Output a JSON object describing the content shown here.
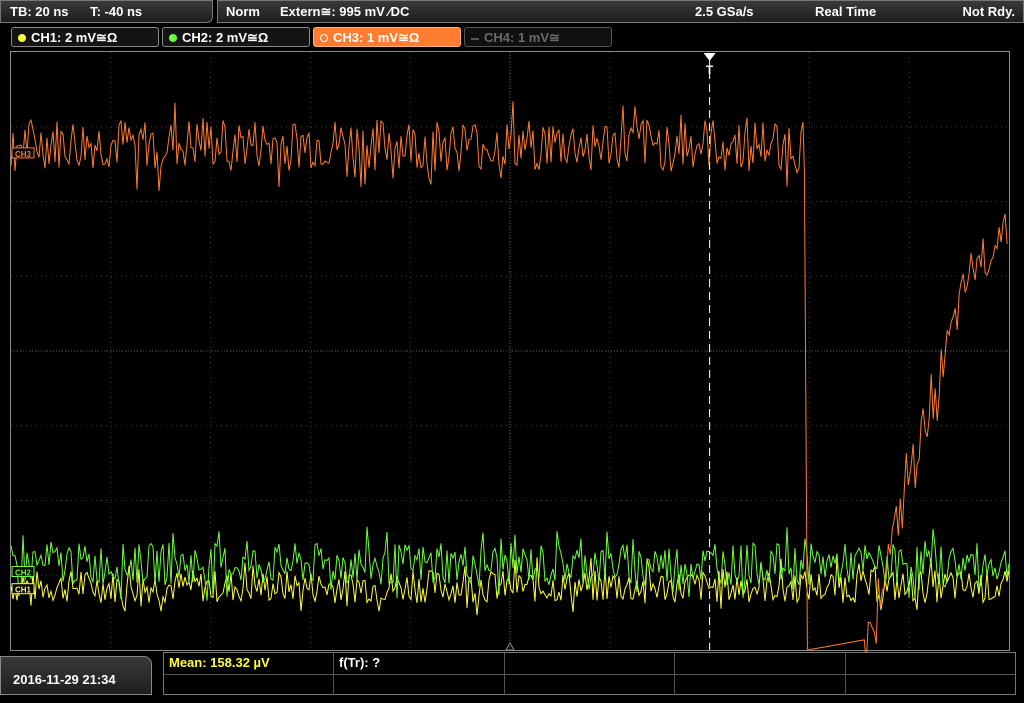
{
  "timebase": {
    "tb": "TB: 20 ns",
    "t": "T: -40 ns"
  },
  "status_bar": {
    "mode": "Norm",
    "trigger": "Extern≅: 995 mV ⁄DC",
    "sample_rate": "2.5 GSa/s",
    "acquisition": "Real Time",
    "ready_state": "Not Rdy."
  },
  "channels": [
    {
      "label": "CH1: 2 mV≅Ω",
      "color": "#ffff3a",
      "state": "on"
    },
    {
      "label": "CH2: 2 mV≅Ω",
      "color": "#6cff3a",
      "state": "on"
    },
    {
      "label": "CH3: 1 mV≅Ω",
      "color": "#ff7c30",
      "state": "selected"
    },
    {
      "label": "CH4: 1 mV≅",
      "color": "#666666",
      "state": "off"
    }
  ],
  "trigger_marker": "T",
  "ground_markers": [
    "CH3",
    "CH2",
    "CH1"
  ],
  "footer": {
    "datetime": "2016-11-29 21:34",
    "mean": "Mean: 158.32 µV",
    "frequency": "f(Tr): ?"
  },
  "colors": {
    "ch1": "#ffff3a",
    "ch2": "#6cff3a",
    "ch3": "#ff7c30",
    "grid": "#3c3c3c",
    "trigger_line": "#ffffff"
  },
  "chart_data": {
    "type": "line",
    "xlabel": "",
    "ylabel": "",
    "x_divisions": 10,
    "y_divisions": 8,
    "series": [
      {
        "name": "CH1",
        "segments": [
          {
            "x": [
              0,
              10
            ],
            "y": [
              -3.15,
              -3.15
            ],
            "noise_div": 0.22
          }
        ]
      },
      {
        "name": "CH2",
        "segments": [
          {
            "x": [
              0,
              10
            ],
            "y": [
              -2.85,
              -2.85
            ],
            "noise_div": 0.28
          }
        ]
      },
      {
        "name": "CH3",
        "segments": [
          {
            "x": [
              0,
              7.95
            ],
            "y": [
              2.75,
              2.75
            ],
            "noise_div": 0.35
          },
          {
            "x": [
              7.95,
              7.98
            ],
            "y": [
              2.4,
              -4.0
            ],
            "noise_div": 0
          },
          {
            "x": [
              8.55,
              9.0,
              9.6,
              10.0
            ],
            "y": [
              -4.0,
              -1.7,
              1.0,
              1.75
            ],
            "noise_div": 0.3
          }
        ]
      }
    ],
    "trigger_x_div": 7.0
  }
}
